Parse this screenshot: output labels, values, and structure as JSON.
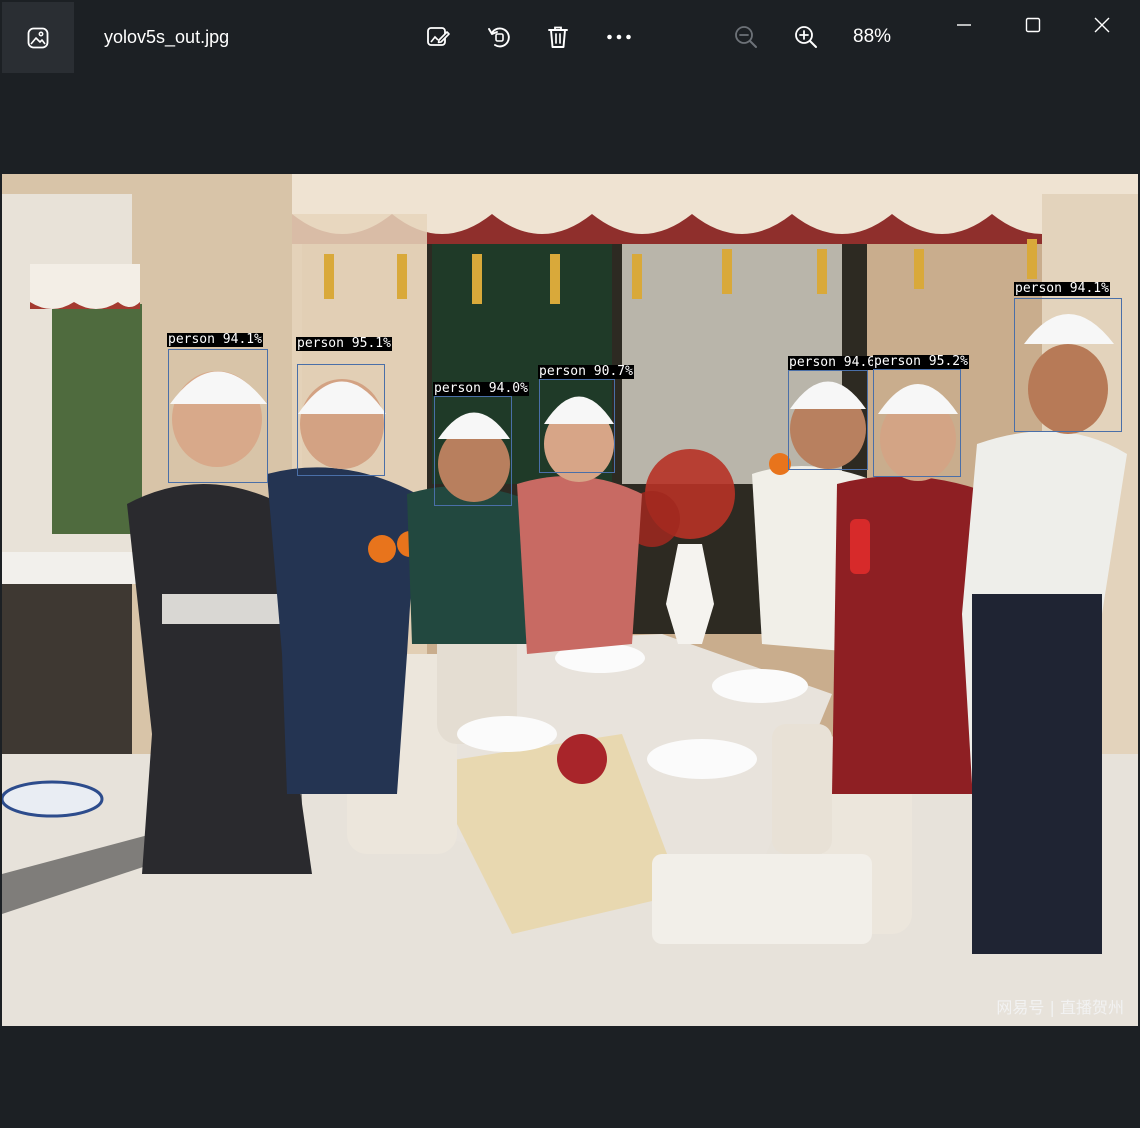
{
  "window": {
    "title": "yolov5s_out.jpg",
    "zoom_label": "88%"
  },
  "toolbar": {
    "app_icon": "photo-app-icon",
    "edit": "edit-image-icon",
    "rotate": "rotate-icon",
    "delete": "trash-icon",
    "more": "more-options-icon",
    "zoom_out": "zoom-out-icon",
    "zoom_in": "zoom-in-icon"
  },
  "window_controls": {
    "minimize": "minimize-icon",
    "maximize": "maximize-icon",
    "close": "close-icon"
  },
  "detections": [
    {
      "label": "person 94.1%"
    },
    {
      "label": "person 95.1%"
    },
    {
      "label": "person 94.0%"
    },
    {
      "label": "person 90.7%"
    },
    {
      "label": "person 94.6%"
    },
    {
      "label": "person 95.2%"
    },
    {
      "label": "person 94.1%"
    }
  ],
  "watermark": "网易号 | 直播贺州",
  "colors": {
    "window_bg": "#1c2024",
    "box_color": "#4a6fa8",
    "label_bg": "#000000"
  }
}
